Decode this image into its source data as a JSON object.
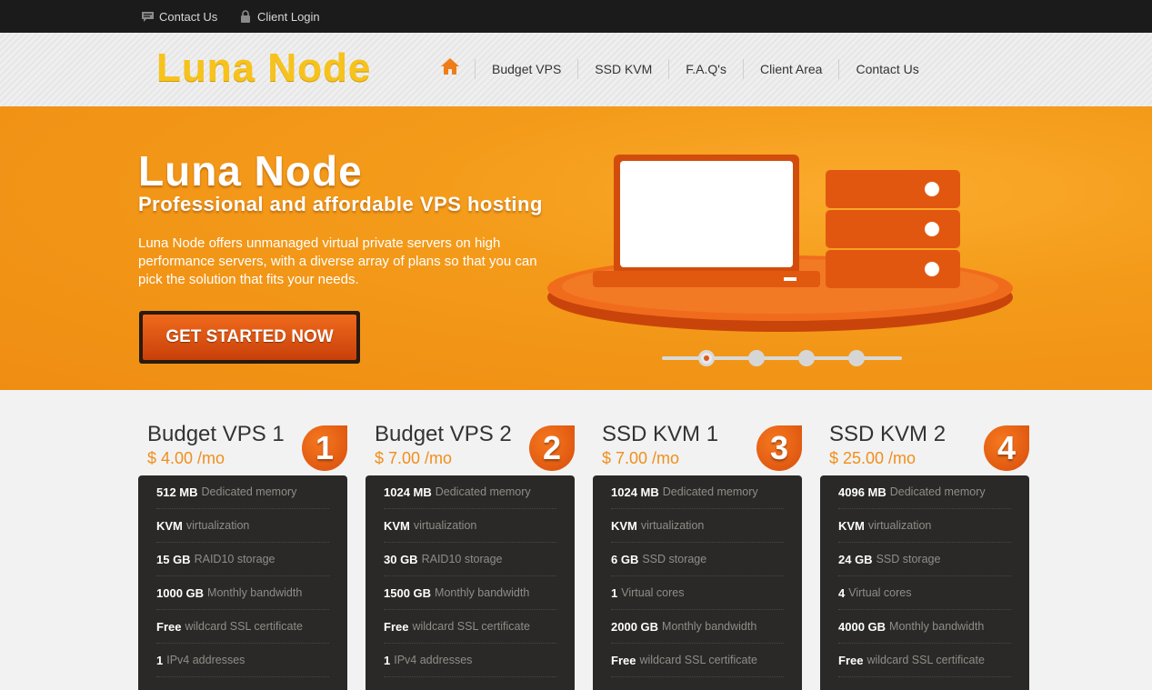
{
  "topbar": {
    "contact": {
      "label": "Contact Us",
      "icon": "speech-bubble-icon"
    },
    "client_login": {
      "label": "Client Login",
      "icon": "lock-icon"
    }
  },
  "header": {
    "logo": "Luna Node",
    "nav": [
      {
        "label": "",
        "icon": "home-icon"
      },
      {
        "label": "Budget VPS"
      },
      {
        "label": "SSD KVM"
      },
      {
        "label": "F.A.Q's"
      },
      {
        "label": "Client Area"
      },
      {
        "label": "Contact Us"
      }
    ]
  },
  "hero": {
    "title": "Luna Node",
    "subtitle": "Professional and affordable VPS hosting",
    "description": "Luna Node offers unmanaged virtual private servers on high performance servers, with a diverse array of plans so that you can pick the solution that fits your needs.",
    "cta": "GET STARTED NOW",
    "slides": {
      "count": 4,
      "active": 1
    }
  },
  "colors": {
    "accent": "#ef8f1c",
    "brand_yellow": "#f7c21c",
    "dark": "#2a2927"
  },
  "plans": [
    {
      "name": "Budget VPS 1",
      "price": "$ 4.00 /mo",
      "number": "1",
      "features": [
        {
          "value": "512 MB",
          "desc": "Dedicated memory"
        },
        {
          "value": "KVM",
          "desc": "virtualization"
        },
        {
          "value": "15 GB",
          "desc": "RAID10 storage"
        },
        {
          "value": "1000 GB",
          "desc": "Monthly bandwidth"
        },
        {
          "value": "Free",
          "desc": "wildcard SSL certificate"
        },
        {
          "value": "1",
          "desc": "IPv4 addresses"
        }
      ]
    },
    {
      "name": "Budget VPS 2",
      "price": "$ 7.00 /mo",
      "number": "2",
      "features": [
        {
          "value": "1024 MB",
          "desc": "Dedicated memory"
        },
        {
          "value": "KVM",
          "desc": "virtualization"
        },
        {
          "value": "30 GB",
          "desc": "RAID10 storage"
        },
        {
          "value": "1500 GB",
          "desc": "Monthly bandwidth"
        },
        {
          "value": "Free",
          "desc": "wildcard SSL certificate"
        },
        {
          "value": "1",
          "desc": "IPv4 addresses"
        }
      ]
    },
    {
      "name": "SSD KVM 1",
      "price": "$ 7.00 /mo",
      "number": "3",
      "features": [
        {
          "value": "1024 MB",
          "desc": "Dedicated memory"
        },
        {
          "value": "KVM",
          "desc": "virtualization"
        },
        {
          "value": "6 GB",
          "desc": "SSD storage"
        },
        {
          "value": "1",
          "desc": "Virtual cores"
        },
        {
          "value": "2000 GB",
          "desc": "Monthly bandwidth"
        },
        {
          "value": "Free",
          "desc": "wildcard SSL certificate"
        }
      ]
    },
    {
      "name": "SSD KVM 2",
      "price": "$ 25.00 /mo",
      "number": "4",
      "features": [
        {
          "value": "4096 MB",
          "desc": "Dedicated memory"
        },
        {
          "value": "KVM",
          "desc": "virtualization"
        },
        {
          "value": "24 GB",
          "desc": "SSD storage"
        },
        {
          "value": "4",
          "desc": "Virtual cores"
        },
        {
          "value": "4000 GB",
          "desc": "Monthly bandwidth"
        },
        {
          "value": "Free",
          "desc": "wildcard SSL certificate"
        }
      ]
    }
  ]
}
